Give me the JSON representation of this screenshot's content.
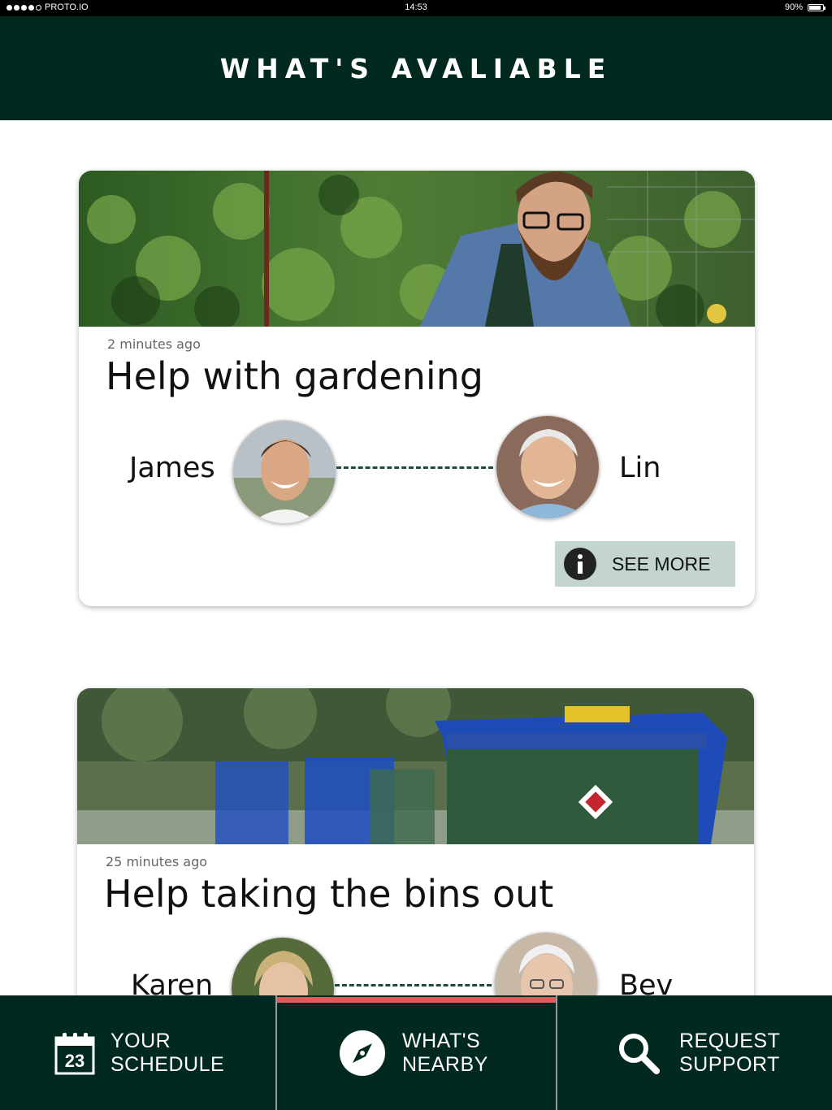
{
  "status_bar": {
    "carrier": "PROTO.IO",
    "time": "14:53",
    "battery": "90%",
    "battery_level": 0.9
  },
  "header": {
    "title": "WHAT'S AVALIABLE"
  },
  "cards": [
    {
      "time": "2 minutes ago",
      "title": "Help with gardening",
      "helper": "James",
      "recipient": "Lin",
      "button_label": "SEE MORE"
    },
    {
      "time": "25 minutes ago",
      "title": "Help taking the bins out",
      "helper": "Karen",
      "recipient": "Bev"
    }
  ],
  "nav": {
    "schedule": {
      "line1": "YOUR",
      "line2": "SCHEDULE",
      "calendar_day": "23"
    },
    "nearby": {
      "line1": "WHAT'S",
      "line2": "NEARBY"
    },
    "support": {
      "line1": "REQUEST",
      "line2": "SUPPORT"
    }
  },
  "colors": {
    "primary": "#02291f",
    "accent": "#e05a5a",
    "button_bg": "#c3d5ce"
  },
  "icons": [
    "info-icon",
    "calendar-icon",
    "compass-icon",
    "search-icon"
  ]
}
